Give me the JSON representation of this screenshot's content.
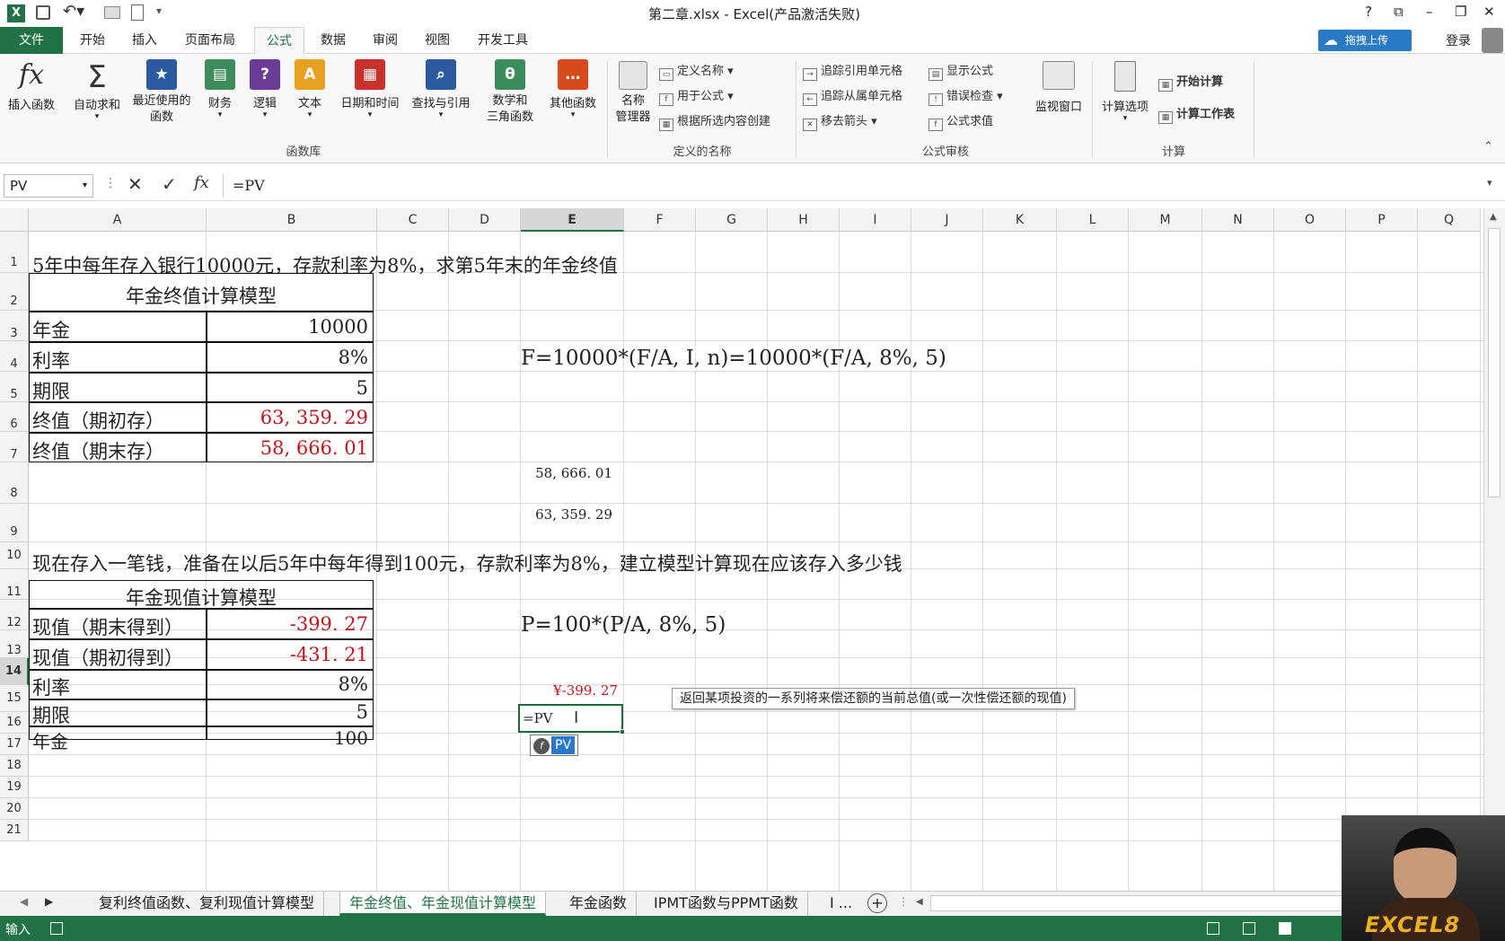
{
  "title": "第二章.xlsx - Excel(产品激活失败)",
  "window_buttons": [
    "?",
    "⧉",
    "–",
    "❐",
    "✕"
  ],
  "tabs": [
    "文件",
    "开始",
    "插入",
    "页面布局",
    "公式",
    "数据",
    "审阅",
    "视图",
    "开发工具"
  ],
  "upload_label": "拖拽上传",
  "login_label": "登录",
  "ribbon": {
    "insert_function": "插入函数",
    "autosum": "自动求和",
    "recent": "最近使用的\n函数",
    "finance": "财务",
    "logic": "逻辑",
    "text": "文本",
    "datetime": "日期和时间",
    "lookup": "查找与引用",
    "math": "数学和\n三角函数",
    "other": "其他函数",
    "group_library": "函数库",
    "name_manager": "名称\n管理器",
    "define_name": "定义名称",
    "use_in_formula": "用于公式",
    "create_from_selection": "根据所选内容创建",
    "group_names": "定义的名称",
    "trace_precedents": "追踪引用单元格",
    "trace_dependents": "追踪从属单元格",
    "remove_arrows": "移去箭头",
    "show_formulas": "显示公式",
    "error_checking": "错误检查",
    "evaluate_formula": "公式求值",
    "watch_window": "监视窗口",
    "group_audit": "公式审核",
    "calc_options": "计算选项",
    "calc_now": "开始计算",
    "calc_sheet": "计算工作表",
    "group_calc": "计算"
  },
  "namebox": "PV",
  "formula": "=PV",
  "columns": [
    "A",
    "B",
    "C",
    "D",
    "E",
    "F",
    "G",
    "H",
    "I",
    "J",
    "K",
    "L",
    "M",
    "N",
    "O",
    "P",
    "Q"
  ],
  "rows": [
    "1",
    "2",
    "3",
    "4",
    "5",
    "6",
    "7",
    "8",
    "9",
    "10",
    "11",
    "12",
    "13",
    "14",
    "15",
    "16",
    "17",
    "18",
    "19",
    "20",
    "21"
  ],
  "cells": {
    "r1": "5年中每年存入银行10000元，存款利率为8%，求第5年末的年金终值",
    "table1_title": "年金终值计算模型",
    "t1_labels": [
      "年金",
      "利率",
      "期限",
      "终值（期初存）",
      "终值（期末存）"
    ],
    "t1_values": [
      "10000",
      "8%",
      "5",
      "63, 359. 29",
      "58, 666. 01"
    ],
    "f_formula": "F=10000*(F/A, I, n)=10000*(F/A, 8%, 5)",
    "e7": "58, 666. 01",
    "e8": "63, 359. 29",
    "r9": "现在存入一笔钱，准备在以后5年中每年得到100元，存款利率为8%，建立模型计算现在应该存入多少钱",
    "table2_title": "年金现值计算模型",
    "t2_labels": [
      "现值（期末得到）",
      "现值（期初得到）",
      "利率",
      "期限",
      "年金"
    ],
    "t2_values": [
      "-399. 27",
      "-431. 21",
      "8%",
      "5",
      "100"
    ],
    "p_formula": "P=100*(P/A, 8%, 5)",
    "e13": "¥-399. 27",
    "e14": "=PV",
    "autocomplete": "PV",
    "tooltip": "返回某项投资的一系列将来偿还额的当前总值(或一次性偿还额的现值)"
  },
  "sheet_tabs": [
    "复利终值函数、复利现值计算模型",
    "年金终值、年金现值计算模型",
    "年金函数",
    "IPMT函数与PPMT函数",
    "I ..."
  ],
  "status_mode": "输入",
  "watermark": "EXCEL8"
}
